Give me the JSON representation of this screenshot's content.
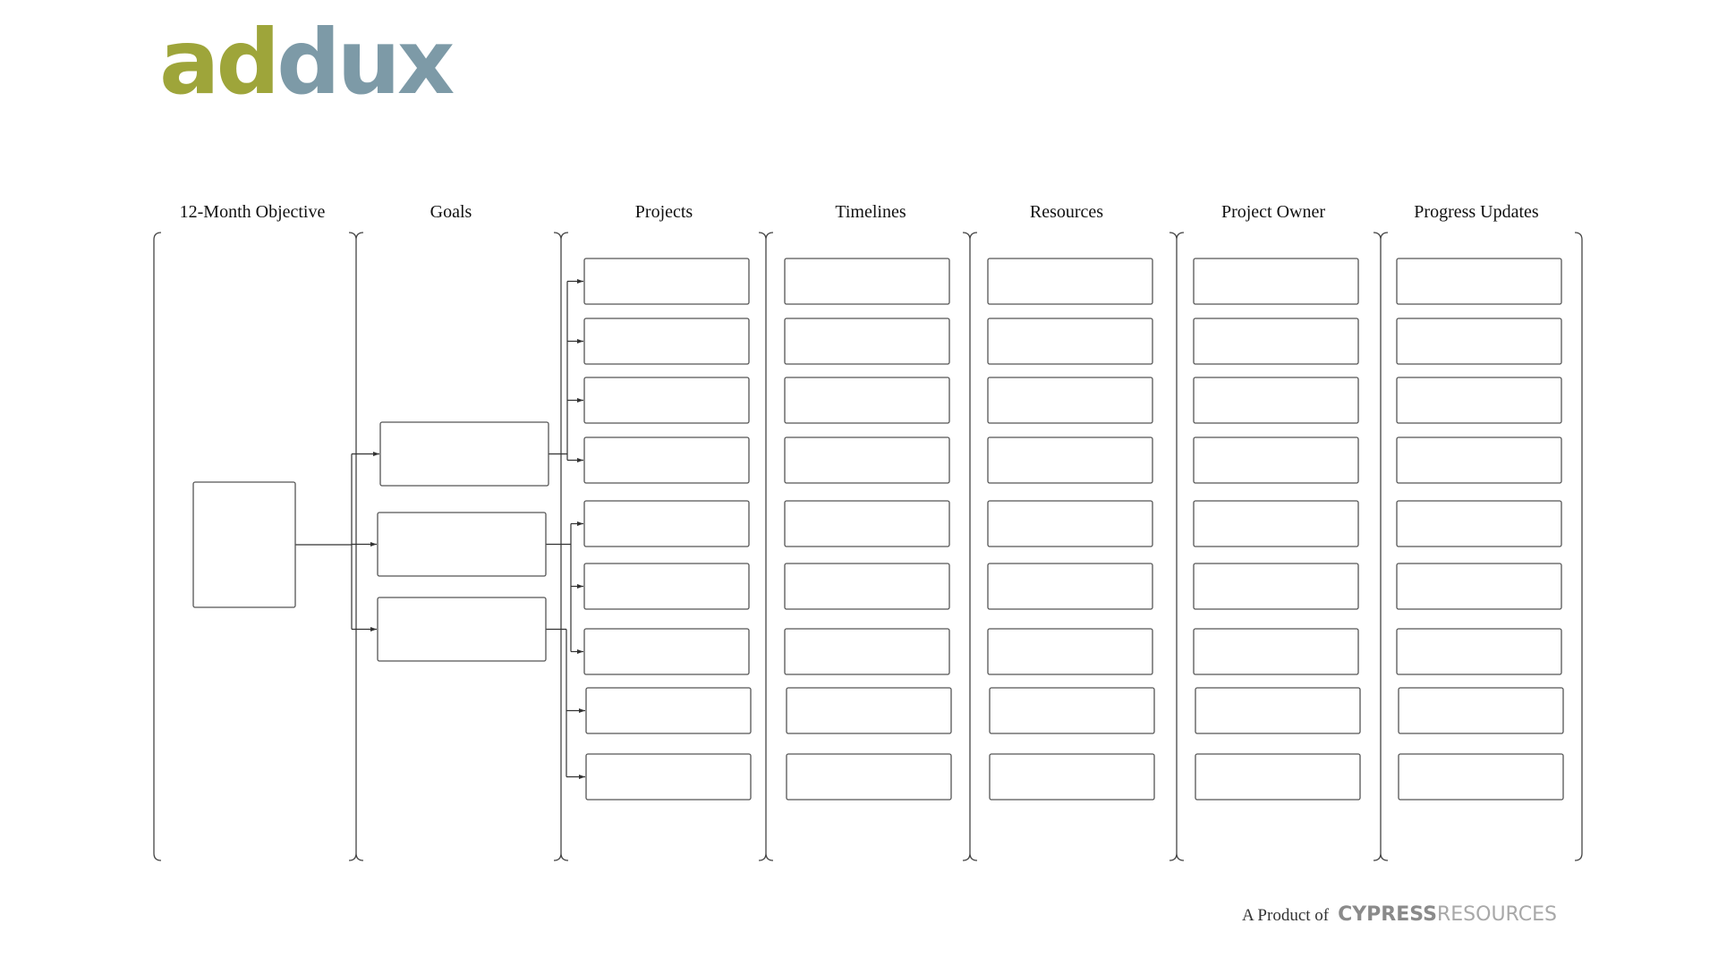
{
  "logo": {
    "part1": "ad",
    "part2": "dux",
    "colors": {
      "ad": "#9ea53a",
      "dux": "#7d9aa7"
    }
  },
  "columns": [
    {
      "label": "12-Month Objective"
    },
    {
      "label": "Goals"
    },
    {
      "label": "Projects"
    },
    {
      "label": "Timelines"
    },
    {
      "label": "Resources"
    },
    {
      "label": "Project Owner"
    },
    {
      "label": "Progress Updates"
    }
  ],
  "structure": {
    "objective_boxes": 1,
    "goal_boxes": 3,
    "rows_per_column": 9,
    "projects_per_goal": [
      4,
      3,
      2
    ]
  },
  "footer": {
    "prefix": "A Product of",
    "brand_bold": "CYPRESS",
    "brand_light": "RESOURCES"
  },
  "colors": {
    "stroke": "#444444",
    "background": "#ffffff"
  }
}
